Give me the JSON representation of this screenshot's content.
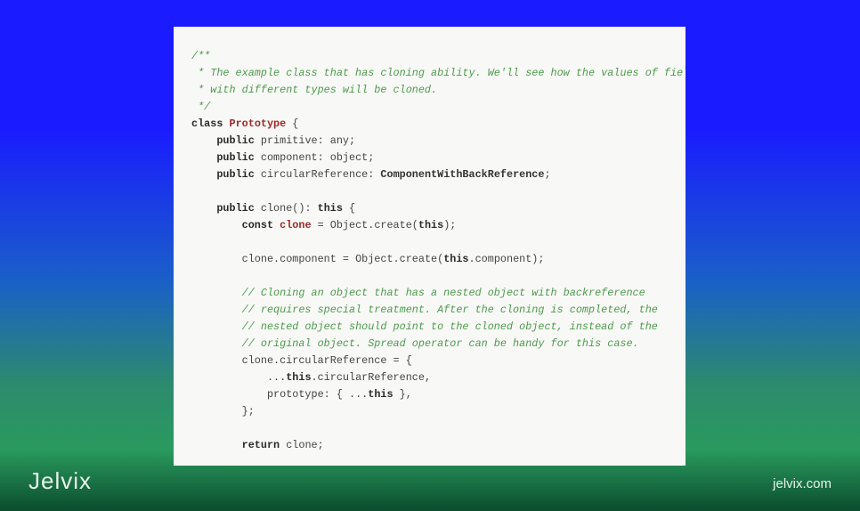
{
  "brand": "Jelvix",
  "site": "jelvix.com",
  "code": {
    "comment_block": {
      "l1": "/**",
      "l2": " * The example class that has cloning ability. We'll see how the values of field",
      "l3": " * with different types will be cloned.",
      "l4": " */"
    },
    "class_kw": "class",
    "class_name": "Prototype",
    "open_brace": " {",
    "member1": {
      "vis": "public",
      "name": " primitive: any;"
    },
    "member2": {
      "vis": "public",
      "name": " component: object;"
    },
    "member3": {
      "vis": "public",
      "name": " circularReference: ",
      "type": "ComponentWithBackReference",
      ";": ";"
    },
    "method": {
      "sig_vis": "public",
      "sig_rest": " clone(): ",
      "sig_this": "this",
      "sig_end": " {",
      "l1_kw": "const ",
      "l1_var": "clone",
      "l1_rest": " = Object.create(",
      "l1_this": "this",
      "l1_end": ");",
      "l2": "clone.component = Object.create(",
      "l2_this": "this",
      "l2_end": ".component);",
      "c1": "// Cloning an object that has a nested object with backreference",
      "c2": "// requires special treatment. After the cloning is completed, the",
      "c3": "// nested object should point to the cloned object, instead of the",
      "c4": "// original object. Spread operator can be handy for this case.",
      "l3": "clone.circularReference = {",
      "l4a": "...",
      "l4b": "this",
      "l4c": ".circularReference,",
      "l5a": "prototype: { ...",
      "l5b": "this",
      "l5c": " },",
      "l6": "};",
      "ret_kw": "return",
      "ret_rest": " clone;"
    }
  }
}
